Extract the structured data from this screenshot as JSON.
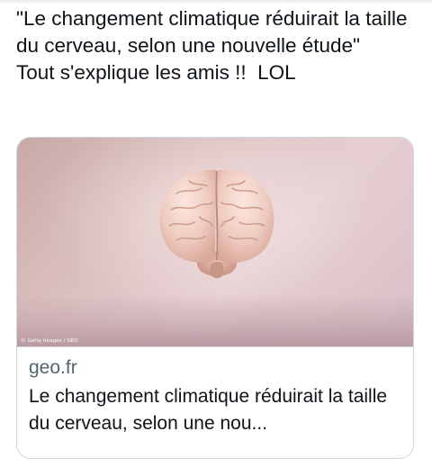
{
  "tweet": {
    "text": "\"Le changement climatique réduirait la taille du cerveau, selon une nouvelle étude\"\nTout s'explique les amis !!  LOL"
  },
  "link_card": {
    "image_credit": "© Getty Images / GEO",
    "image_subject": "brain",
    "domain": "geo.fr",
    "title": "Le changement climatique réduirait la taille du cerveau, selon une nou..."
  },
  "colors": {
    "text_primary": "#0f1419",
    "text_secondary": "#536471",
    "card_border": "#cfd9de"
  }
}
